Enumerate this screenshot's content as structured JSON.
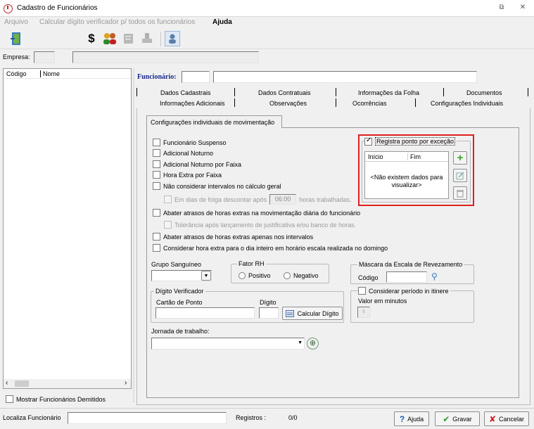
{
  "window": {
    "title": "Cadastro de Funcionários"
  },
  "menu": {
    "arquivo": "Arquivo",
    "calcular": "Calcular dígito verificador p/ todos os funcionários",
    "ajuda": "Ajuda"
  },
  "toolbar": {
    "dollar": "$"
  },
  "empresa": {
    "label": "Empresa:",
    "code": "",
    "name": ""
  },
  "list": {
    "col_codigo": "Código",
    "col_nome": "Nome",
    "mostrar_demitidos": "Mostrar Funcionários Demitidos"
  },
  "funcionario": {
    "label": "Funcionário:",
    "code": "",
    "name": ""
  },
  "tabs": {
    "row1": [
      "Dados Cadastrais",
      "Dados Contratuais",
      "Informações da Folha",
      "Documentos"
    ],
    "row2": [
      "Informações Adicionais",
      "Observações",
      "Ocorrências",
      "Configurações Individuais"
    ]
  },
  "subtab": "Configurações individuais de movimentação",
  "options": {
    "suspenso": "Funcionário Suspenso",
    "noturno": "Adicional Noturno",
    "noturno_faixa": "Adicional Noturno por Faixa",
    "extra_faixa": "Hora Extra por Faixa",
    "intervalos": "Não considerar intervalos no cálculo geral",
    "folga_prefix": "Em dias de folga descontar após",
    "folga_value": "06:00",
    "folga_suffix": "horas trabalhadas.",
    "abater_atrasos": "Abater atrasos de horas extras na movimentação diária do funcionário",
    "tolerancia": "Tolerância após lançamento de justificativa e/ou banco de horas.",
    "abater_intervalos": "Abater atrasos de horas extras apenas nos intervalos",
    "dia_inteiro": "Considerar hora extra para o dia inteiro em horário escala realizada no domingo"
  },
  "excecao": {
    "label": "Registra ponto por exceção",
    "col_inicio": "Início",
    "col_fim": "Fim",
    "empty": "<Não existem dados para visualizar>"
  },
  "grupo_sanguineo": {
    "label": "Grupo Sanguíneo",
    "value": ""
  },
  "fator_rh": {
    "label": "Fator RH",
    "positivo": "Positivo",
    "negativo": "Negativo"
  },
  "mascara": {
    "label": "Máscara da Escala de Revezamento",
    "codigo": "Código",
    "value": ""
  },
  "digito": {
    "label": "Dígito Verificador",
    "cartao": "Cartão de Ponto",
    "digito": "Dígito",
    "calcular": "Calcular Dígito"
  },
  "itinere": {
    "label": "Considerar período in itinere",
    "minutos": "Valor em minutos"
  },
  "jornada": {
    "label": "Jornada de trabalho:"
  },
  "footer": {
    "localiza": "Localiza Funcionário",
    "registros_label": "Registros :",
    "registros_value": "0/0",
    "ajuda": "Ajuda",
    "gravar": "Gravar",
    "cancelar": "Cancelar"
  },
  "colors": {
    "highlight": "#e02020",
    "title_icon": "#c0272d"
  }
}
